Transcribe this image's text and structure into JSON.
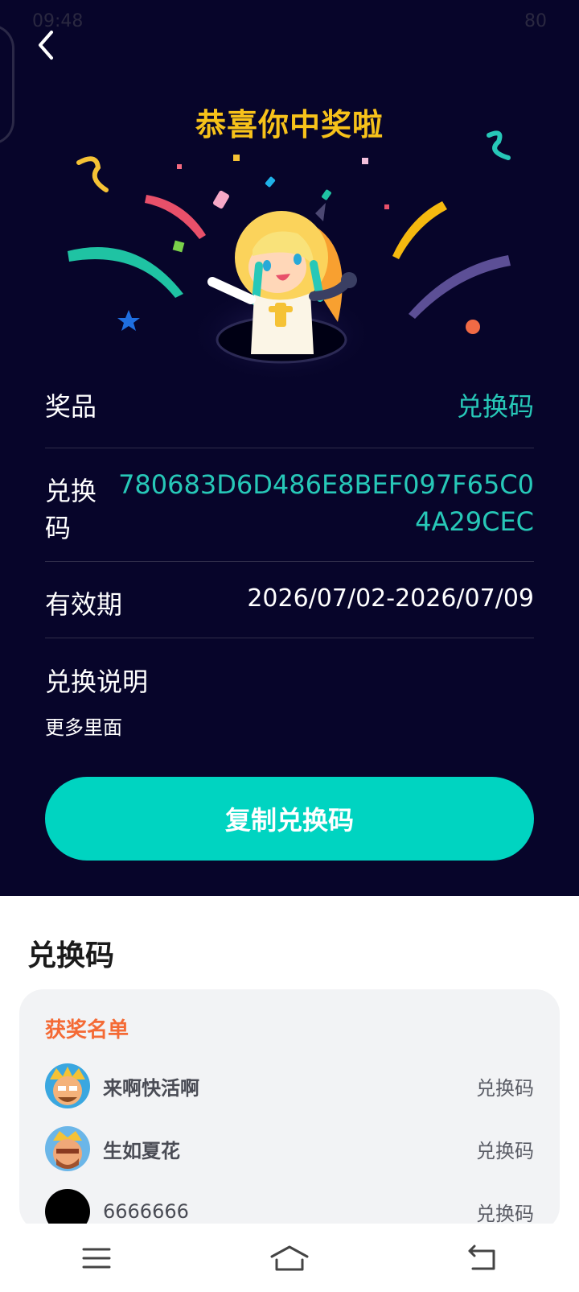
{
  "status_bar": {
    "time": "09:48",
    "battery": "80"
  },
  "header": {
    "title": "恭喜你中奖啦"
  },
  "details": {
    "prize_label": "奖品",
    "prize_value": "兑换码",
    "code_label": "兑换码",
    "code_line1": "780683D6D486E8BEF097F65C0",
    "code_line2": "4A29CEC",
    "validity_label": "有效期",
    "validity_value": "2026/07/02-2026/07/09",
    "instructions_title": "兑换说明",
    "instructions_text": "更多里面"
  },
  "actions": {
    "copy_label": "复制兑换码"
  },
  "section": {
    "title": "兑换码"
  },
  "winners": {
    "title": "获奖名单",
    "items": [
      {
        "name": "来啊快活啊",
        "prize": "兑换码"
      },
      {
        "name": "生如夏花",
        "prize": "兑换码"
      },
      {
        "name": "6666666",
        "prize": "兑换码"
      }
    ]
  },
  "colors": {
    "background": "#07052a",
    "accent": "#00d4c1",
    "title": "#f7c21a",
    "winners_title": "#f46a35"
  }
}
